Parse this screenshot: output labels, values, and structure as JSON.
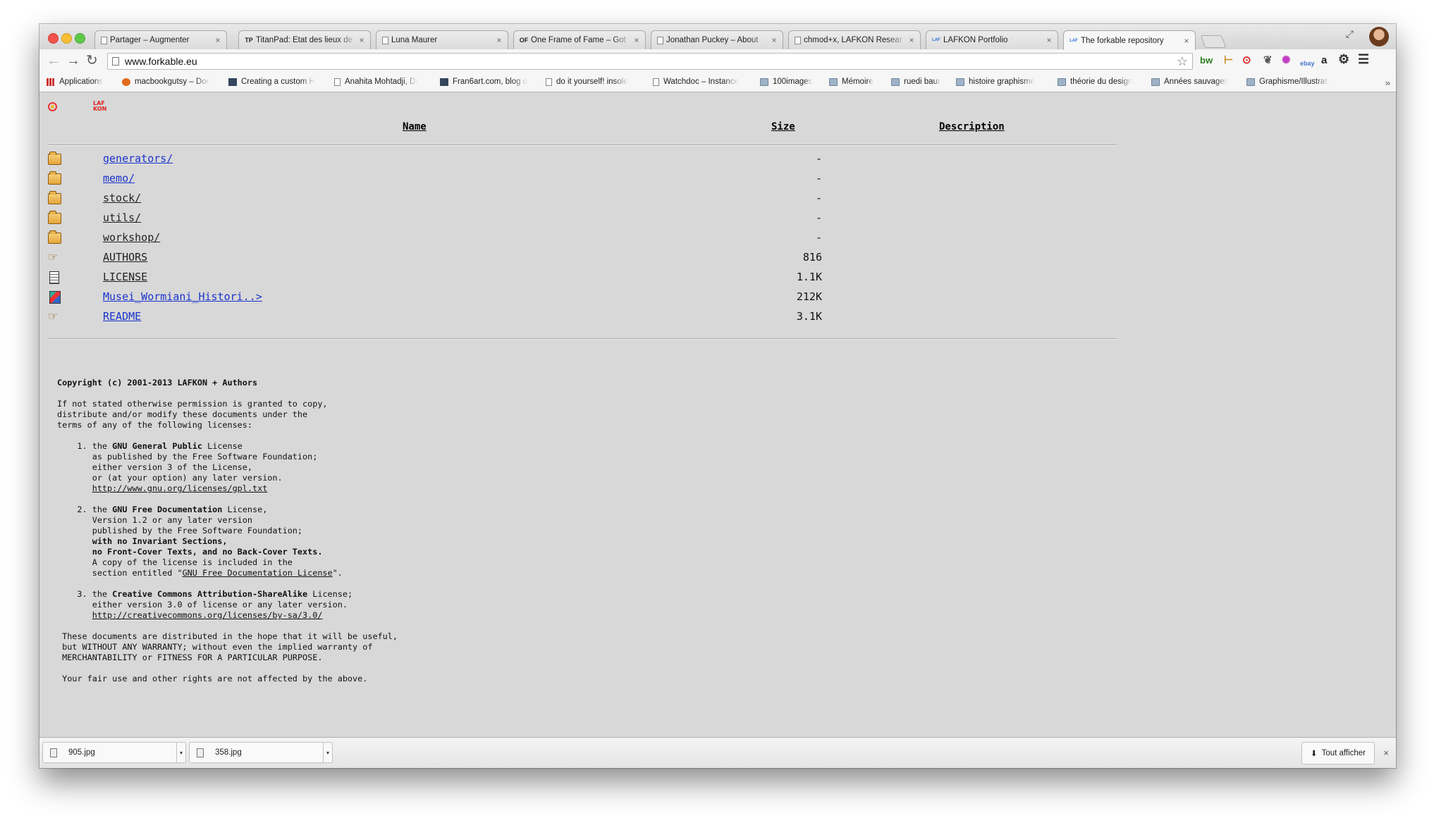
{
  "browser": {
    "tabs": [
      {
        "title": "Partager – Augmenter",
        "favicon": "page"
      },
      {
        "title": "TitanPad: État des lieux de",
        "favicon": "TP"
      },
      {
        "title": "Luna Maurer",
        "favicon": "page"
      },
      {
        "title": "One Frame of Fame – Got",
        "favicon": "OF"
      },
      {
        "title": "Jonathan Puckey – About",
        "favicon": "page"
      },
      {
        "title": "chmod+x, LAFKON Resear",
        "favicon": "page"
      },
      {
        "title": "LAFKON Portfolio",
        "favicon": "LAF"
      },
      {
        "title": "The forkable repository",
        "favicon": "LAF",
        "active": true
      }
    ],
    "url": "www.forkable.eu",
    "extensions": [
      "bw",
      "ruler-icon",
      "record-icon",
      "evernote-icon",
      "colorwheel-icon",
      "ebay",
      "a",
      "gear-icon",
      "menu-icon"
    ],
    "bookmarks": [
      {
        "label": "Applications",
        "icon": "apps"
      },
      {
        "label": "macbookgutsy – Doc",
        "icon": "dot"
      },
      {
        "label": "Creating a custom H",
        "icon": "t"
      },
      {
        "label": "Anahita Mohtadji, Di",
        "icon": "page"
      },
      {
        "label": "Fran6art.com, blog d",
        "icon": "t"
      },
      {
        "label": "do it yourself! insole",
        "icon": "page"
      },
      {
        "label": "Watchdoc – Instance",
        "icon": "page"
      },
      {
        "label": "100images",
        "icon": "folder"
      },
      {
        "label": "Mémoire",
        "icon": "folder"
      },
      {
        "label": "ruedi baur",
        "icon": "folder"
      },
      {
        "label": "histoire graphisme",
        "icon": "folder"
      },
      {
        "label": "théorie du design",
        "icon": "folder"
      },
      {
        "label": "Années sauvages",
        "icon": "folder"
      },
      {
        "label": "Graphisme/Illustrati",
        "icon": "folder"
      }
    ],
    "bookmarks_more": "»"
  },
  "listing": {
    "headers": {
      "name": "Name",
      "size": "Size",
      "description": "Description"
    },
    "logo_text": "LAF\nKON",
    "rows": [
      {
        "name": "generators/",
        "size": "-",
        "icon": "folder",
        "style": "link"
      },
      {
        "name": "memo/",
        "size": "-",
        "icon": "folder",
        "style": "link"
      },
      {
        "name": "stock/",
        "size": "-",
        "icon": "folder",
        "style": "visited"
      },
      {
        "name": "utils/",
        "size": "-",
        "icon": "folder",
        "style": "visited"
      },
      {
        "name": "workshop/",
        "size": "-",
        "icon": "folder",
        "style": "visited"
      },
      {
        "name": "AUTHORS",
        "size": "816",
        "icon": "hand",
        "style": "visited"
      },
      {
        "name": "LICENSE",
        "size": "1.1K",
        "icon": "text",
        "style": "visited"
      },
      {
        "name": "Musei_Wormiani_Histori..>",
        "size": "212K",
        "icon": "image",
        "style": "link"
      },
      {
        "name": "README",
        "size": "3.1K",
        "icon": "hand",
        "style": "link"
      }
    ]
  },
  "license": {
    "copyright": "Copyright (c) 2001-2013 LAFKON + Authors",
    "intro": "If not stated otherwise permission is granted to copy,\ndistribute and/or modify these documents under the\nterms of any of the following licenses:",
    "item1": {
      "num": "    1. the ",
      "bold": "GNU General Public",
      "rest": " License\n       as published by the Free Software Foundation;\n       either version 3 of the License,\n       or (at your option) any later version.\n       ",
      "link": "http://www.gnu.org/licenses/gpl.txt"
    },
    "item2": {
      "num": "    2. the ",
      "bold": "GNU Free Documentation",
      "rest": " License,\n       Version 1.2 or any later version\n       published by the Free Software Foundation;\n       ",
      "bold2": "with no Invariant Sections,\n       no Front-Cover Texts, and no Back-Cover Texts.",
      "rest2": "\n       A copy of the license is included in the\n       section entitled \"",
      "link": "GNU Free Documentation License",
      "end": "\"."
    },
    "item3": {
      "num": "    3. the ",
      "bold": "Creative Commons Attribution-ShareAlike",
      "rest": " License;\n       either version 3.0 of license or any later version.\n       ",
      "link": "http://creativecommons.org/licenses/by-sa/3.0/"
    },
    "disclaimer": " These documents are distributed in the hope that it will be useful,\n but WITHOUT ANY WARRANTY; without even the implied warranty of\n MERCHANTABILITY or FITNESS FOR A PARTICULAR PURPOSE.",
    "rights": " Your fair use and other rights are not affected by the above."
  },
  "downloads": {
    "items": [
      {
        "name": "905.jpg"
      },
      {
        "name": "358.jpg"
      }
    ],
    "show_all": "Tout afficher",
    "close": "×"
  }
}
